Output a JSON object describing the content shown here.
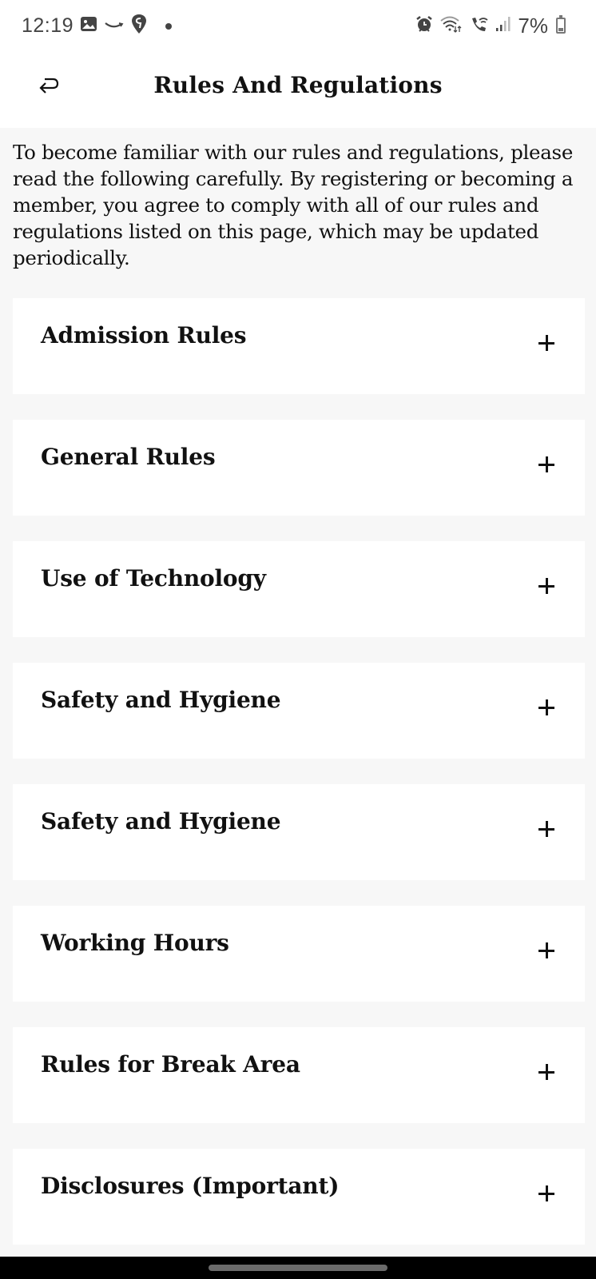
{
  "status_bar": {
    "time": "12:19",
    "left_icons": [
      "gallery-icon",
      "amazon-icon",
      "swiggy-icon",
      "dot-icon"
    ],
    "right_icons": [
      "alarm-icon",
      "wifi-icon",
      "wifi-calling-icon",
      "signal-icon"
    ],
    "battery_percent": "7%"
  },
  "header": {
    "back_icon": "return-arrow-icon",
    "title": "Rules And Regulations"
  },
  "intro_text": "To become familiar with our rules and regulations, please read the following carefully. By registering or becoming a member, you agree to comply with all of our rules and regulations listed on this page, which may be updated periodically.",
  "sections": [
    {
      "title": "Admission Rules",
      "icon": "plus-icon"
    },
    {
      "title": "General Rules",
      "icon": "plus-icon"
    },
    {
      "title": "Use of Technology",
      "icon": "plus-icon"
    },
    {
      "title": "Safety and Hygiene",
      "icon": "plus-icon"
    },
    {
      "title": "Safety and Hygiene",
      "icon": "plus-icon"
    },
    {
      "title": "Working Hours",
      "icon": "plus-icon"
    },
    {
      "title": "Rules for Break Area",
      "icon": "plus-icon"
    },
    {
      "title": "Disclosures (Important)",
      "icon": "plus-icon"
    }
  ],
  "colors": {
    "page_background": "#f7f7f7",
    "card_background": "#ffffff",
    "text": "#111111"
  }
}
